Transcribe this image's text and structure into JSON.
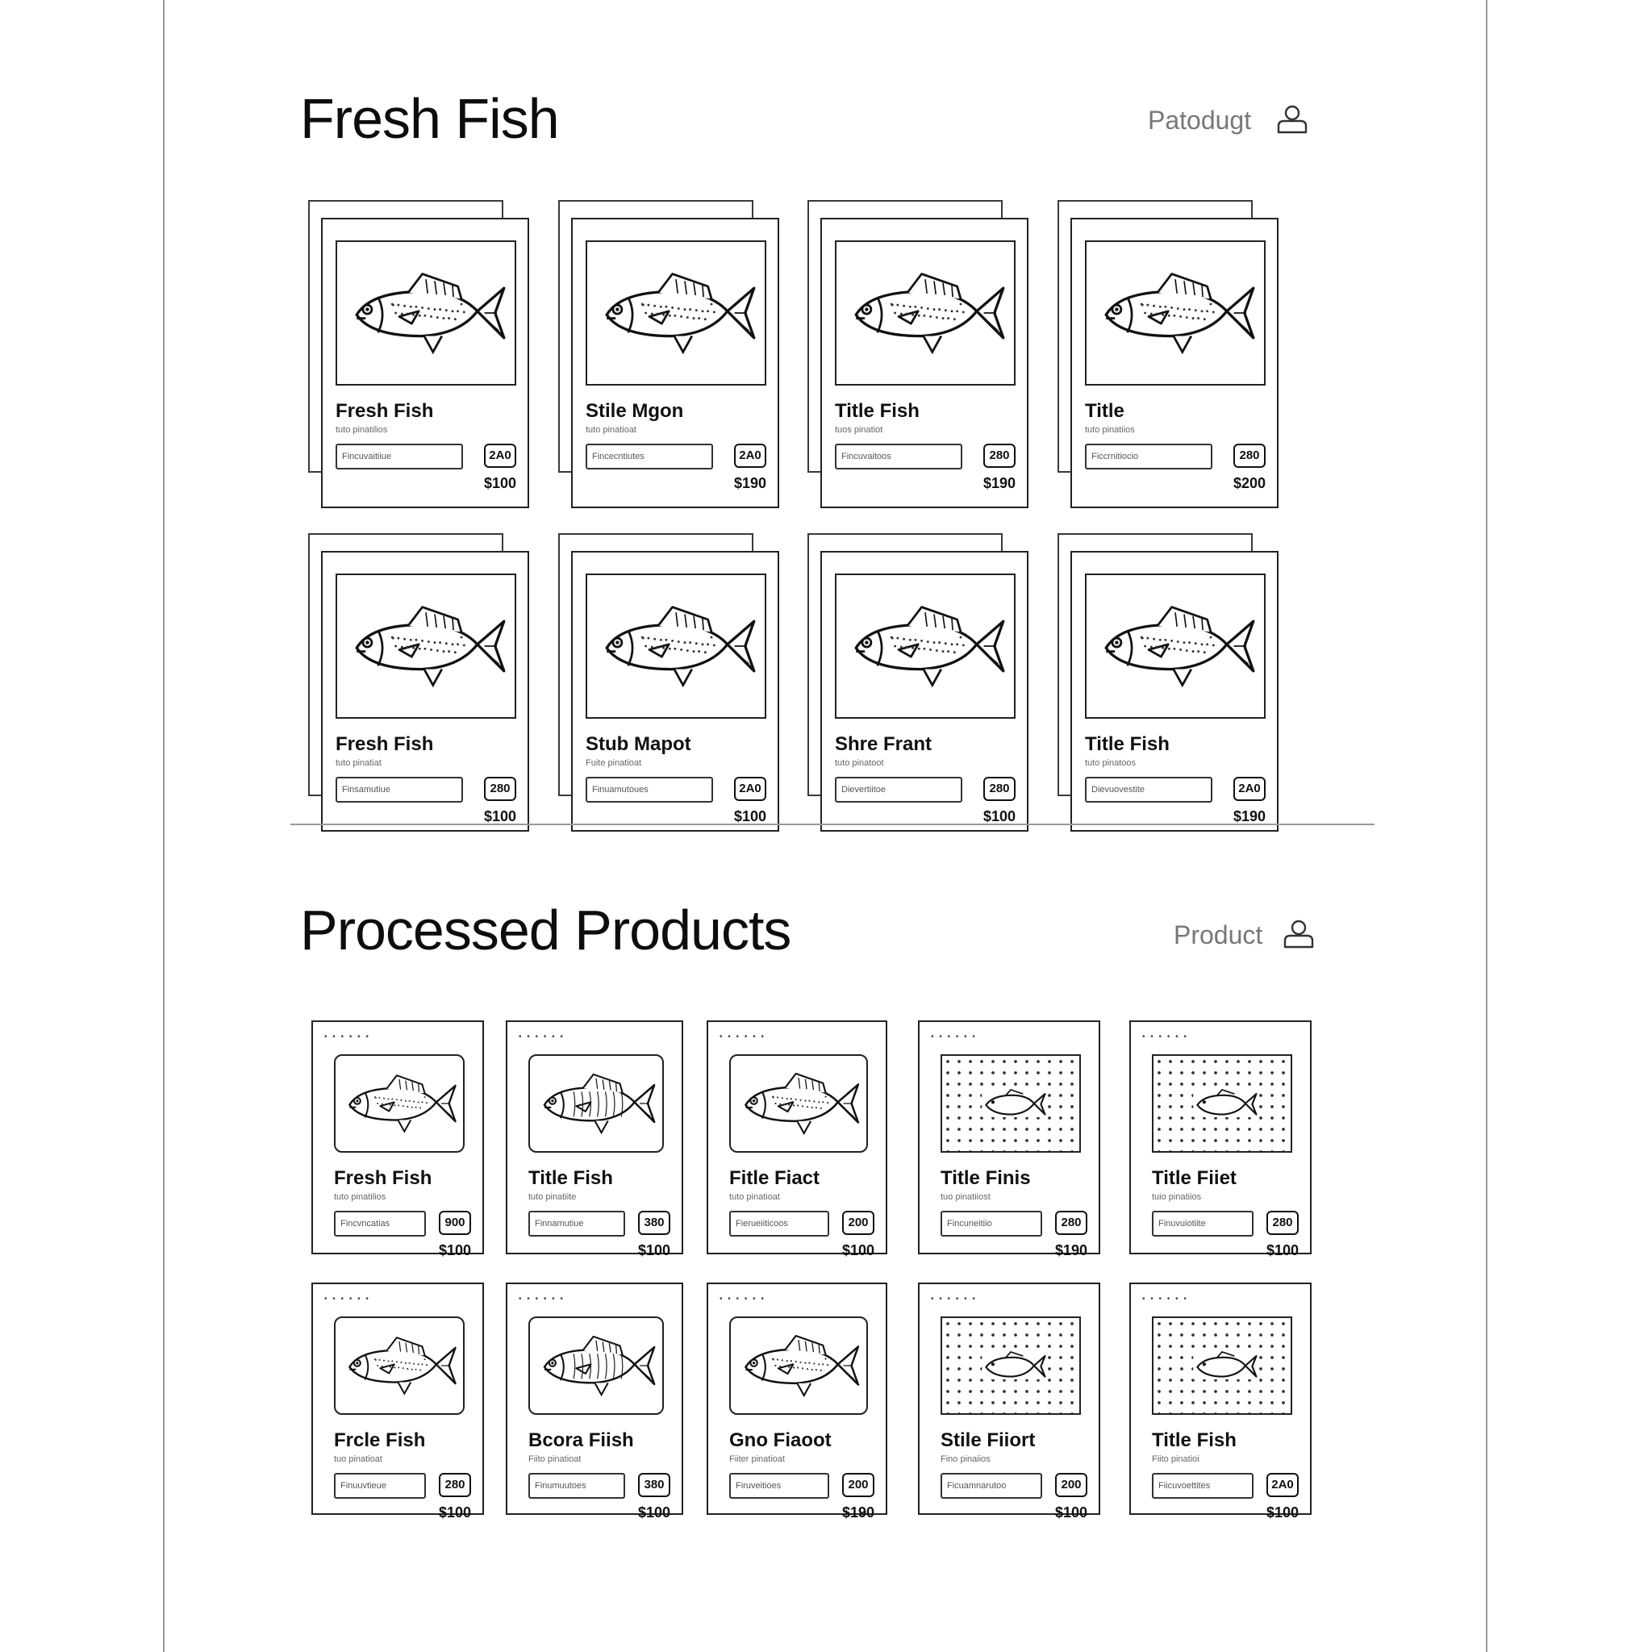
{
  "fresh": {
    "title": "Fresh Fish",
    "link": "Patodugt",
    "cards": [
      {
        "title": "Fresh Fish",
        "sub": "tuto pinatilios",
        "field": "Fincuvaitiiue",
        "qty": "2A0",
        "price": "$100"
      },
      {
        "title": "Stile Mgon",
        "sub": "tuto pinatioat",
        "field": "Fincecntiutes",
        "qty": "2A0",
        "price": "$190"
      },
      {
        "title": "Title Fish",
        "sub": "tuos pinatiot",
        "field": "Fincuvaitoos",
        "qty": "280",
        "price": "$190"
      },
      {
        "title": "Title",
        "sub": "tuto pinatiios",
        "field": "Ficcrnitiocio",
        "qty": "280",
        "price": "$200"
      },
      {
        "title": "Fresh Fish",
        "sub": "tuto pinatiat",
        "field": "Finsamutiue",
        "qty": "280",
        "price": "$100"
      },
      {
        "title": "Stub Mapot",
        "sub": "Fuite pinatioat",
        "field": "Finuamutoues",
        "qty": "2A0",
        "price": "$100"
      },
      {
        "title": "Shre Frant",
        "sub": "tuto pinatoot",
        "field": "Dievertiitoe",
        "qty": "280",
        "price": "$100"
      },
      {
        "title": "Title Fish",
        "sub": "tuto pinatoos",
        "field": "Dievuovestite",
        "qty": "2A0",
        "price": "$190"
      }
    ]
  },
  "processed": {
    "title": "Processed Products",
    "link": "Product",
    "cards": [
      {
        "title": "Fresh Fish",
        "sub": "tuto pinatilios",
        "field": "Fincvncatias",
        "qty": "900",
        "price": "$100"
      },
      {
        "title": "Title Fish",
        "sub": "tuto pinatiite",
        "field": "Finnamutiue",
        "qty": "380",
        "price": "$100"
      },
      {
        "title": "Fitle Fiact",
        "sub": "tuto pinatioat",
        "field": "Fierueiiticoos",
        "qty": "200",
        "price": "$100"
      },
      {
        "title": "Title Finis",
        "sub": "tuo pinatiiost",
        "field": "Fincuneitiio",
        "qty": "280",
        "price": "$190"
      },
      {
        "title": "Title Fiiet",
        "sub": "tuio pinatiios",
        "field": "Finuvuiotiite",
        "qty": "280",
        "price": "$100"
      },
      {
        "title": "Frcle Fish",
        "sub": "tuo pinatioat",
        "field": "Finuuvtieue",
        "qty": "280",
        "price": "$100"
      },
      {
        "title": "Bcora Fiish",
        "sub": "Fiito pinatioat",
        "field": "Finumuutoes",
        "qty": "380",
        "price": "$100"
      },
      {
        "title": "Gno Fiaoot",
        "sub": "Fiiter pinatioat",
        "field": "Firuveitioes",
        "qty": "200",
        "price": "$190"
      },
      {
        "title": "Stile Fiiort",
        "sub": "Fino pinaiios",
        "field": "Ficuamnarutoo",
        "qty": "200",
        "price": "$100"
      },
      {
        "title": "Title Fish",
        "sub": "Fiito pinatioi",
        "field": "Fiicuvoettites",
        "qty": "2A0",
        "price": "$100"
      }
    ]
  },
  "icons": {
    "user": "user-icon",
    "fish": "fish-icon"
  },
  "colors": {
    "ink": "#111111",
    "muted": "#777777",
    "background": "#ffffff"
  }
}
